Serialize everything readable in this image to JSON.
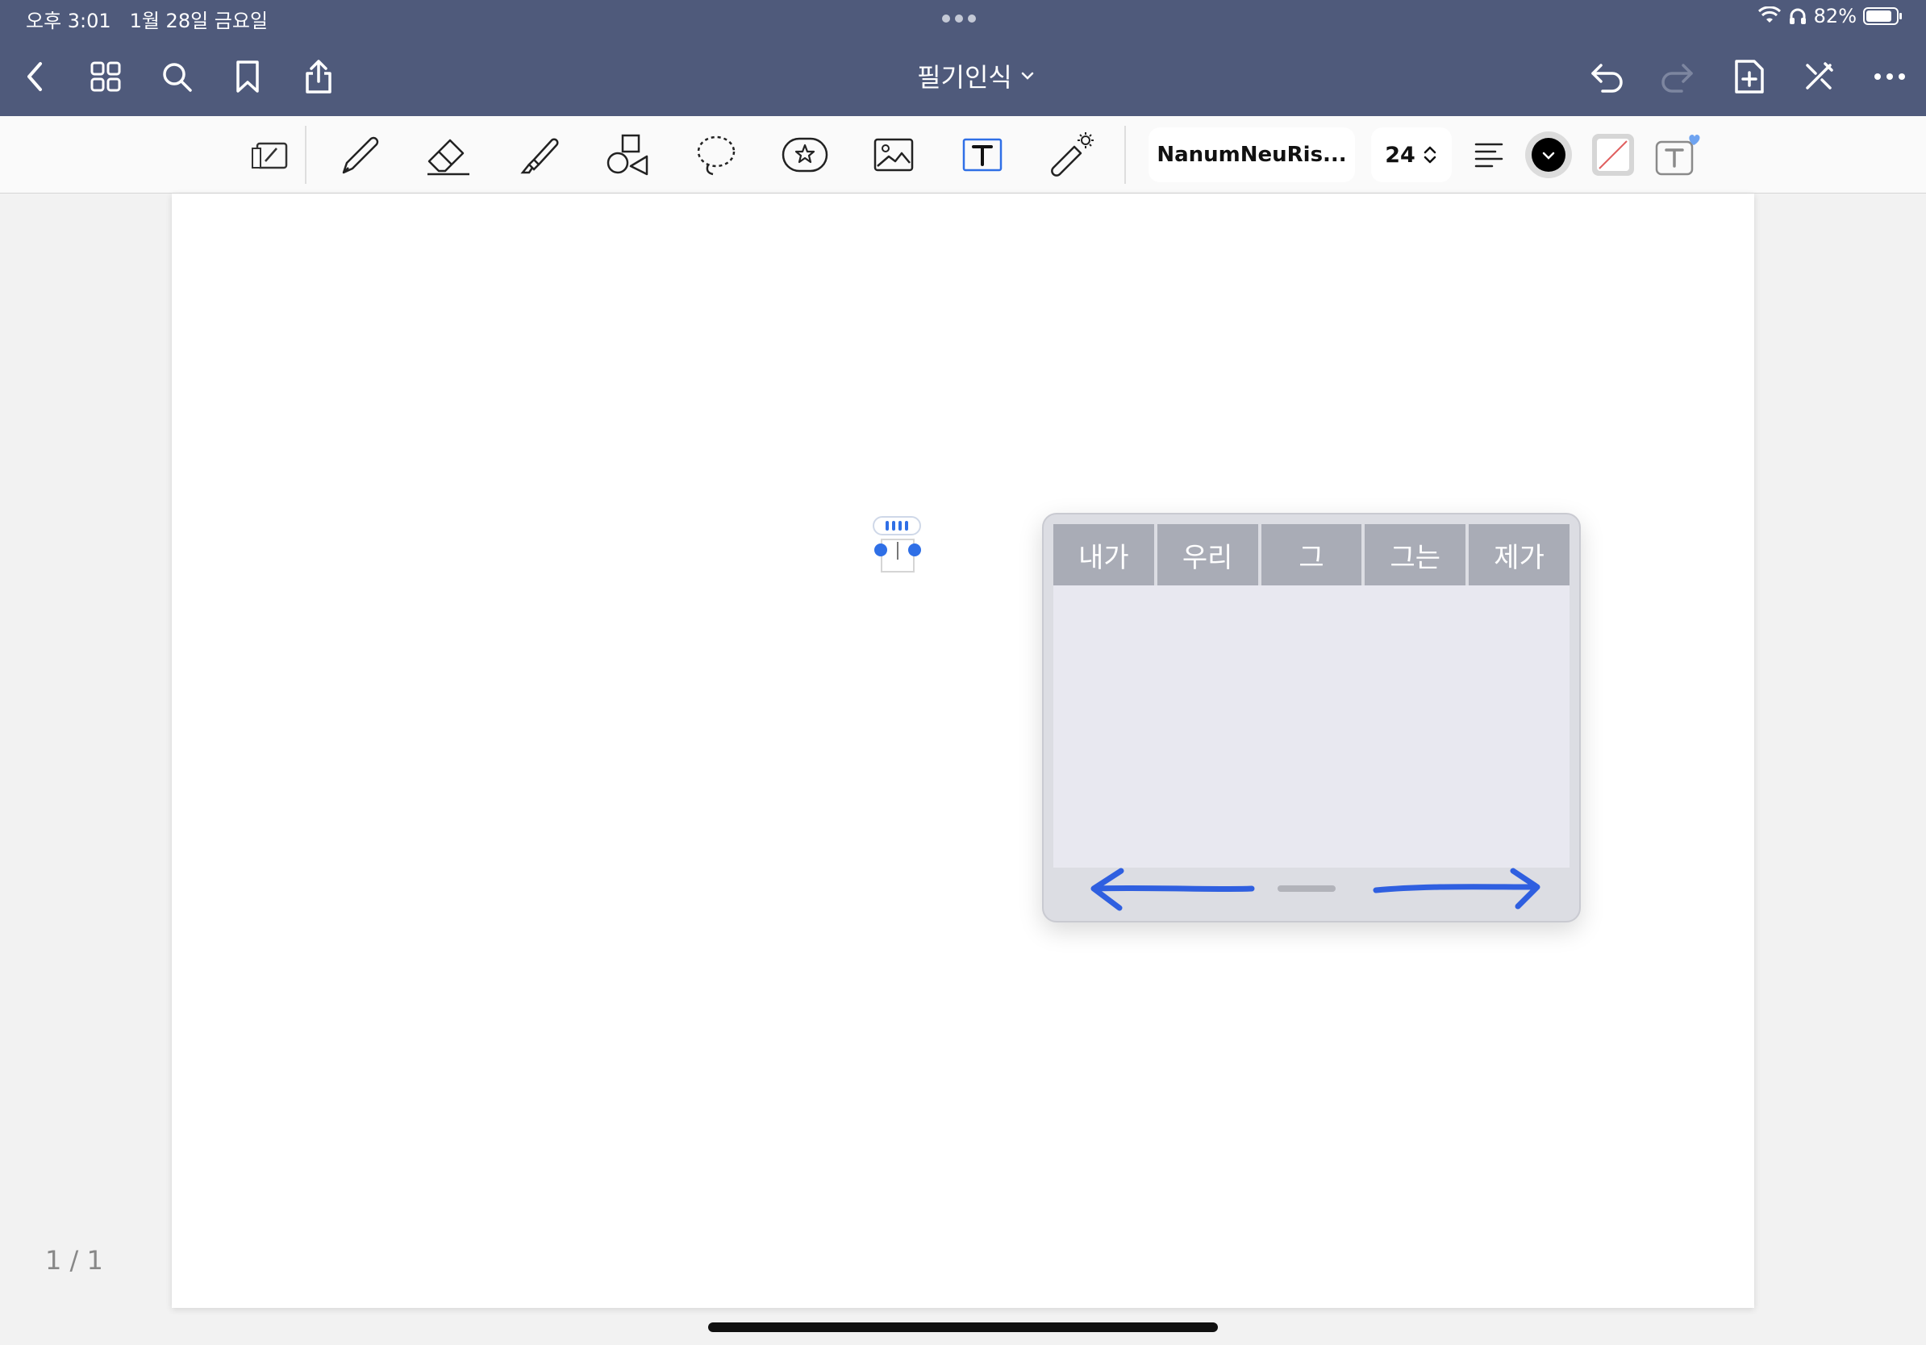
{
  "status": {
    "time": "오후 3:01",
    "date": "1월 28일 금요일",
    "battery": "82%"
  },
  "nav": {
    "title": "필기인식",
    "icons": [
      "back-icon",
      "grid-icon",
      "search-icon",
      "bookmark-icon",
      "share-icon",
      "undo-icon",
      "redo-icon",
      "add-page-icon",
      "close-pen-icon",
      "more-icon"
    ]
  },
  "toolbar": {
    "font_name": "NanumNeuRis...",
    "font_size": "24",
    "text_color": "#000000",
    "accent": "#2f6fe6"
  },
  "handwriting": {
    "candidates": [
      "내가",
      "우리",
      "그",
      "그는",
      "제가"
    ]
  },
  "page": {
    "indicator": "1 / 1"
  }
}
